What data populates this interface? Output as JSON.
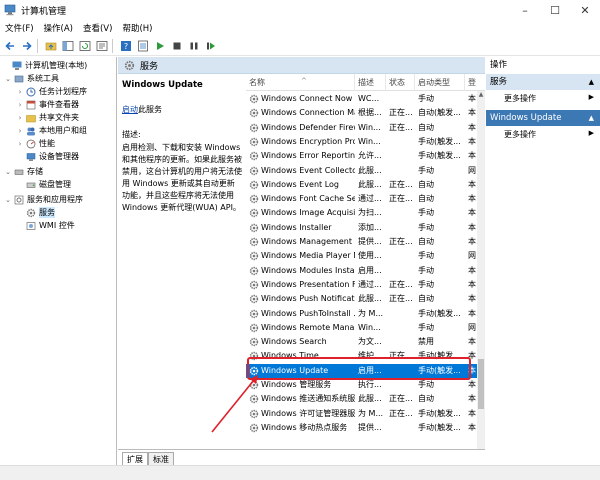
{
  "window": {
    "title": "计算机管理"
  },
  "menu": [
    "文件(F)",
    "操作(A)",
    "查看(V)",
    "帮助(H)"
  ],
  "tree": {
    "root": "计算机管理(本地)",
    "system_tools": "系统工具",
    "task_scheduler": "任务计划程序",
    "event_viewer": "事件查看器",
    "shared_folders": "共享文件夹",
    "local_users": "本地用户和组",
    "performance": "性能",
    "device_manager": "设备管理器",
    "storage": "存储",
    "disk_management": "磁盘管理",
    "services_apps": "服务和应用程序",
    "services": "服务",
    "wmi": "WMI 控件"
  },
  "center": {
    "header": "服务",
    "service_name": "Windows Update",
    "start_link": "启动",
    "start_suffix": "此服务",
    "desc_label": "描述:",
    "desc_text": "启用检测、下载和安装 Windows 和其他程序的更新。如果此服务被禁用，这台计算机的用户将无法使用 Windows 更新或其自动更新功能，并且这些程序将无法使用 Windows 更新代理(WUA) API。"
  },
  "columns": {
    "name": "名称",
    "desc": "描述",
    "status": "状态",
    "startup": "启动类型",
    "logon": "登"
  },
  "services": [
    {
      "name": "Windows Connect Now -...",
      "desc": "WC...",
      "status": "",
      "startup": "手动",
      "logon": "本"
    },
    {
      "name": "Windows Connection Ma...",
      "desc": "根据...",
      "status": "正在...",
      "startup": "自动(触发...",
      "logon": "本"
    },
    {
      "name": "Windows Defender Firew...",
      "desc": "Win...",
      "status": "正在...",
      "startup": "自动",
      "logon": "本"
    },
    {
      "name": "Windows Encryption Pro...",
      "desc": "Win...",
      "status": "",
      "startup": "手动(触发...",
      "logon": "本"
    },
    {
      "name": "Windows Error Reportin...",
      "desc": "允许...",
      "status": "",
      "startup": "手动(触发...",
      "logon": "本"
    },
    {
      "name": "Windows Event Collector",
      "desc": "此服...",
      "status": "",
      "startup": "手动",
      "logon": "网"
    },
    {
      "name": "Windows Event Log",
      "desc": "此服...",
      "status": "正在...",
      "startup": "自动",
      "logon": "本"
    },
    {
      "name": "Windows Font Cache Ser...",
      "desc": "通过...",
      "status": "正在...",
      "startup": "自动",
      "logon": "本"
    },
    {
      "name": "Windows Image Acquisiti...",
      "desc": "为扫...",
      "status": "",
      "startup": "手动",
      "logon": "本"
    },
    {
      "name": "Windows Installer",
      "desc": "添加...",
      "status": "",
      "startup": "手动",
      "logon": "本"
    },
    {
      "name": "Windows Management I...",
      "desc": "提供...",
      "status": "正在...",
      "startup": "自动",
      "logon": "本"
    },
    {
      "name": "Windows Media Player N...",
      "desc": "使用...",
      "status": "",
      "startup": "手动",
      "logon": "网"
    },
    {
      "name": "Windows Modules Install...",
      "desc": "启用...",
      "status": "",
      "startup": "手动",
      "logon": "本"
    },
    {
      "name": "Windows Presentation Fo...",
      "desc": "通过...",
      "status": "正在...",
      "startup": "手动",
      "logon": "本"
    },
    {
      "name": "Windows Push Notificati...",
      "desc": "此服...",
      "status": "正在...",
      "startup": "自动",
      "logon": "本"
    },
    {
      "name": "Windows PushToInstall ...",
      "desc": "为 M...",
      "status": "",
      "startup": "手动(触发...",
      "logon": "本"
    },
    {
      "name": "Windows Remote Manag...",
      "desc": "Win...",
      "status": "",
      "startup": "手动",
      "logon": "网"
    },
    {
      "name": "Windows Search",
      "desc": "为文...",
      "status": "",
      "startup": "禁用",
      "logon": "本"
    },
    {
      "name": "Windows Time",
      "desc": "维护...",
      "status": "正在...",
      "startup": "手动(触发...",
      "logon": "本"
    },
    {
      "name": "Windows Update",
      "desc": "启用...",
      "status": "",
      "startup": "手动(触发...",
      "logon": "本"
    },
    {
      "name": "Windows 管理服务",
      "desc": "执行...",
      "status": "",
      "startup": "手动",
      "logon": "本"
    },
    {
      "name": "Windows 推送通知系统服务",
      "desc": "此服...",
      "status": "正在...",
      "startup": "自动",
      "logon": "本"
    },
    {
      "name": "Windows 许可证管理器服务",
      "desc": "为 M...",
      "status": "正在...",
      "startup": "手动(触发...",
      "logon": "本"
    },
    {
      "name": "Windows 移动热点服务",
      "desc": "提供...",
      "status": "",
      "startup": "手动(触发...",
      "logon": "本"
    }
  ],
  "selected_service_index": 19,
  "tabs": {
    "extended": "扩展",
    "standard": "标准"
  },
  "actions": {
    "header": "操作",
    "section1": "服务",
    "more1": "更多操作",
    "section2": "Windows Update",
    "more2": "更多操作"
  },
  "colors": {
    "selection": "#0078d7",
    "highlight_box": "#e0202a",
    "section_header": "#d7e4f2"
  }
}
